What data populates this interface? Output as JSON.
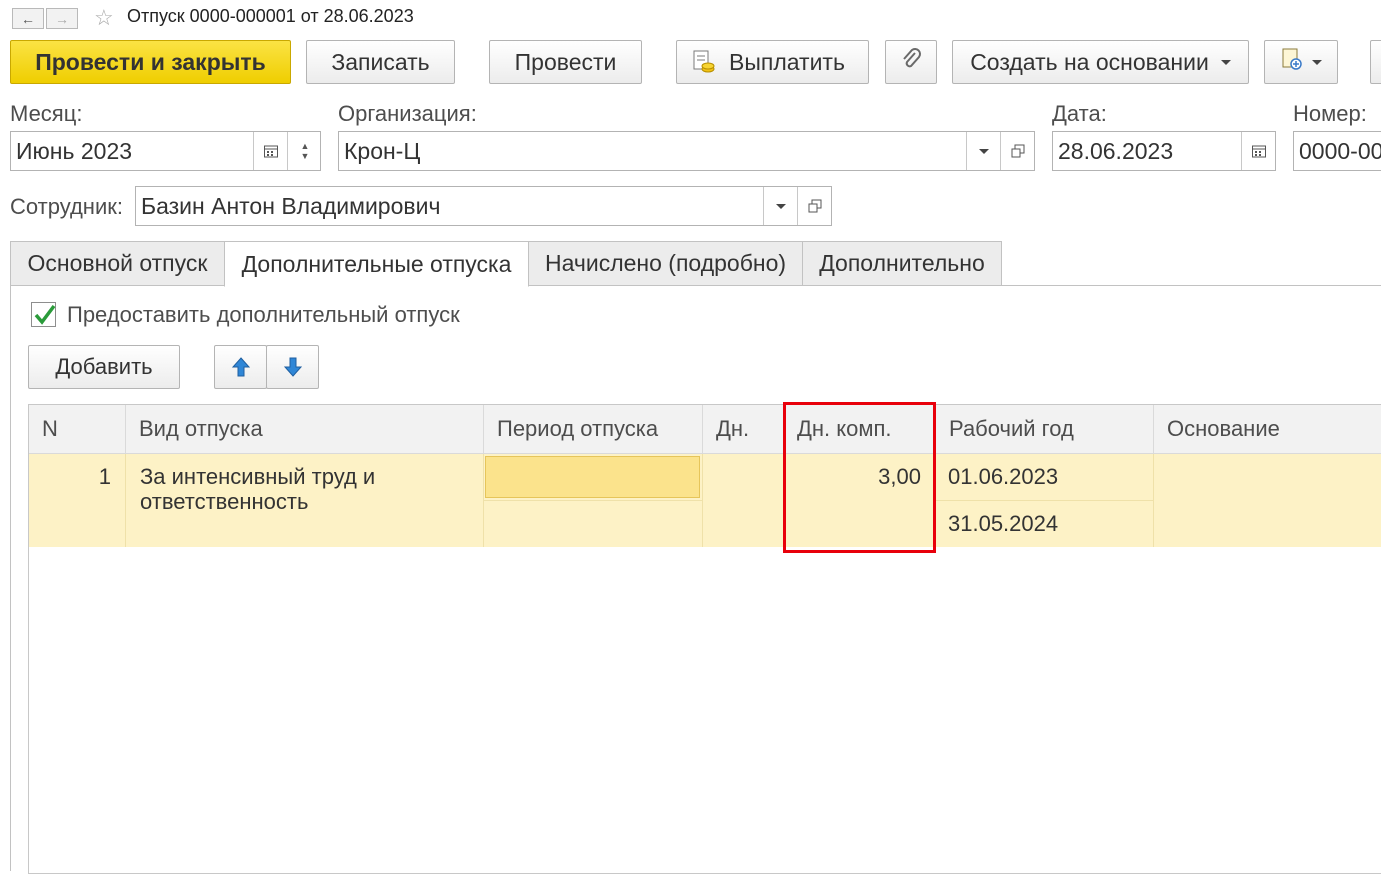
{
  "window": {
    "title": "Отпуск 0000-000001 от 28.06.2023",
    "back_icon": "←",
    "forward_icon": "→",
    "favorite_icon": "☆"
  },
  "toolbar": {
    "post_close": "Провести и закрыть",
    "save": "Записать",
    "post": "Провести",
    "pay": "Выплатить",
    "create_based": "Создать на основании"
  },
  "form": {
    "month_label": "Месяц:",
    "month_value": "Июнь 2023",
    "org_label": "Организация:",
    "org_value": "Крон-Ц",
    "date_label": "Дата:",
    "date_value": "28.06.2023",
    "number_label": "Номер:",
    "number_value": "0000-00",
    "employee_label": "Сотрудник:",
    "employee_value": "Базин Антон Владимирович"
  },
  "tabs": [
    {
      "label": "Основной отпуск"
    },
    {
      "label": "Дополнительные отпуска"
    },
    {
      "label": "Начислено (подробно)"
    },
    {
      "label": "Дополнительно"
    }
  ],
  "panel": {
    "checkbox_label": "Предоставить дополнительный отпуск",
    "checkbox_checked": true,
    "add_button": "Добавить",
    "up_icon": "arrow-up-icon",
    "down_icon": "arrow-down-icon"
  },
  "table": {
    "columns": [
      "N",
      "Вид отпуска",
      "Период отпуска",
      "Дн.",
      "Дн. комп.",
      "Рабочий год",
      "Основание"
    ],
    "rows": [
      {
        "n": "1",
        "kind_line1": "За интенсивный труд и",
        "kind_line2": "ответственность",
        "period": "",
        "days": "",
        "comp_days": "3,00",
        "year_start": "01.06.2023",
        "year_end": "31.05.2024",
        "basis": ""
      }
    ]
  },
  "colors": {
    "accent_yellow": "#f5d52a",
    "row_highlight": "#fdf2c6",
    "highlight_frame": "#e8000b",
    "check_green": "#2a9b3a",
    "arrow_blue": "#2f86d6"
  }
}
